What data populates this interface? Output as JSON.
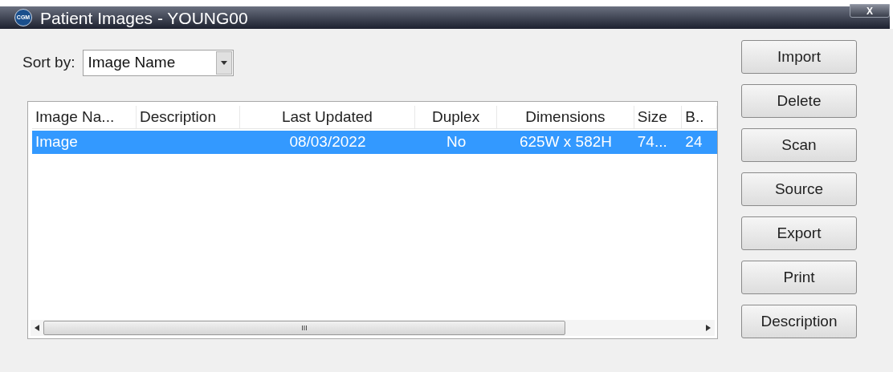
{
  "window": {
    "title": "Patient Images - YOUNG00",
    "logo": "CGM",
    "close": "X"
  },
  "sort": {
    "label": "Sort by:",
    "value": "Image Name"
  },
  "table": {
    "columns": [
      {
        "label": "Image Na...",
        "kind": "left"
      },
      {
        "label": "Description",
        "kind": "left"
      },
      {
        "label": "Last Updated",
        "kind": "center"
      },
      {
        "label": "Duplex",
        "kind": "center"
      },
      {
        "label": "Dimensions",
        "kind": "center"
      },
      {
        "label": "Size",
        "kind": "left"
      },
      {
        "label": "B..",
        "kind": "left"
      }
    ],
    "rows": [
      {
        "selected": true,
        "cells": [
          "Image",
          "",
          "08/03/2022",
          "No",
          "625W x 582H",
          "74...",
          "24"
        ]
      }
    ],
    "scroll_thumb": "III"
  },
  "buttons": [
    "Import",
    "Delete",
    "Scan",
    "Source",
    "Export",
    "Print",
    "Description"
  ]
}
